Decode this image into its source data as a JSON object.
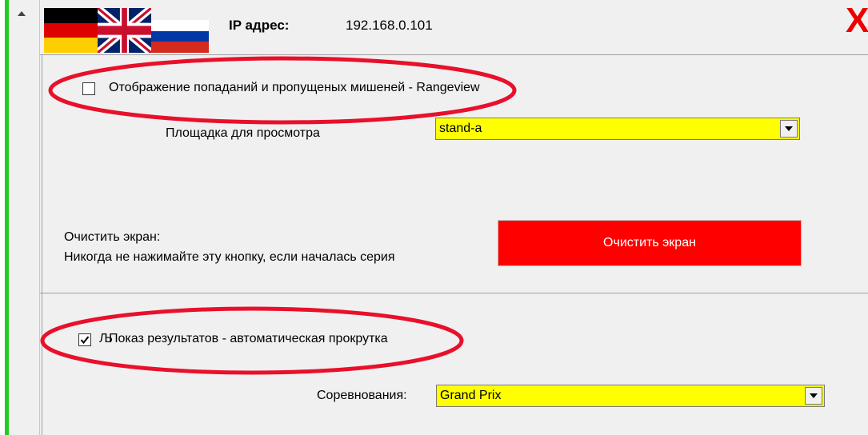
{
  "header": {
    "flags": [
      {
        "name": "german-flag",
        "colors": [
          "#000000",
          "#dd0000",
          "#ffce00"
        ]
      },
      {
        "name": "uk-flag",
        "colors": [
          "#012169",
          "#ffffff",
          "#c8102e"
        ]
      },
      {
        "name": "russian-flag",
        "colors": [
          "#ffffff",
          "#0039a6",
          "#d52b1e"
        ]
      }
    ],
    "ip_label": "IP адрес:",
    "ip_value": "192.168.0.101",
    "close_label": "X"
  },
  "rangeview": {
    "checkbox_label": "Отображение попаданий и пропущеных мишеней - Rangeview",
    "checked": false,
    "stand_label": "Площадка для просмотра",
    "stand_value": "stand-a"
  },
  "clear": {
    "title": "Очистить экран:",
    "warning": "Никогда не нажимайте эту кнопку, если началась серия",
    "button_label": "Очистить экран"
  },
  "results": {
    "checkbox_prefix": "Љ",
    "checkbox_label": "Показ результатов - автоматическая прокрутка",
    "checked": true,
    "competition_label": "Соревнования:",
    "competition_value": "Grand Prix"
  },
  "colors": {
    "highlight_ellipse": "#e8102a",
    "dropdown_bg": "#ffff00",
    "clear_button_bg": "#ff0000",
    "left_bar": "#22cc22"
  }
}
